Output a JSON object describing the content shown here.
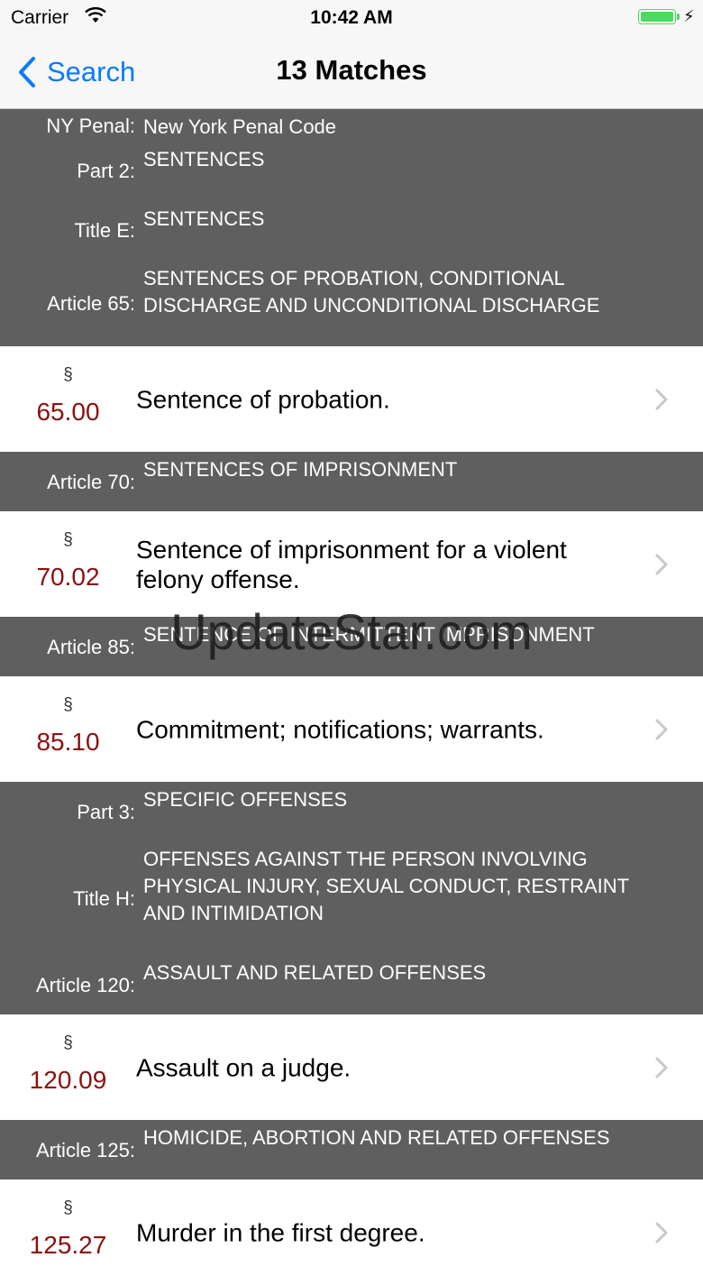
{
  "status_bar": {
    "carrier": "Carrier",
    "time": "10:42 AM"
  },
  "nav": {
    "back_label": "Search",
    "title": "13 Matches"
  },
  "header1": {
    "rows": [
      {
        "label": "NY Penal:",
        "text": "New York Penal Code"
      },
      {
        "label": "Part 2:",
        "text": "SENTENCES"
      },
      {
        "label": "Title E:",
        "text": "SENTENCES"
      },
      {
        "label": "Article 65:",
        "text": "SENTENCES OF PROBATION, CONDITIONAL DISCHARGE AND UNCONDITIONAL DISCHARGE"
      }
    ]
  },
  "row1": {
    "symbol": "§",
    "section": "65.00",
    "title": "Sentence of probation."
  },
  "header2": {
    "rows": [
      {
        "label": "Article 70:",
        "text": "SENTENCES OF IMPRISONMENT"
      }
    ]
  },
  "row2": {
    "symbol": "§",
    "section": "70.02",
    "title": "Sentence of imprisonment for a violent felony offense."
  },
  "header3": {
    "rows": [
      {
        "label": "Article 85:",
        "text": "SENTENCE OF INTERMITTENT IMPRISONMENT"
      }
    ]
  },
  "row3": {
    "symbol": "§",
    "section": "85.10",
    "title": "Commitment; notifications; warrants."
  },
  "header4": {
    "rows": [
      {
        "label": "Part 3:",
        "text": "SPECIFIC OFFENSES"
      },
      {
        "label": "Title H:",
        "text": "OFFENSES AGAINST THE PERSON INVOLVING PHYSICAL INJURY, SEXUAL CONDUCT, RESTRAINT AND INTIMIDATION"
      },
      {
        "label": "Article 120:",
        "text": "ASSAULT AND RELATED OFFENSES"
      }
    ]
  },
  "row4": {
    "symbol": "§",
    "section": "120.09",
    "title": "Assault on a judge."
  },
  "header5": {
    "rows": [
      {
        "label": "Article 125:",
        "text": "HOMICIDE, ABORTION AND RELATED OFFENSES"
      }
    ]
  },
  "row5": {
    "symbol": "§",
    "section": "125.27",
    "title": "Murder in the first degree."
  },
  "watermark": "UpdateStar.com",
  "colors": {
    "accent": "#0a7aff",
    "header_bg": "#5f5f5f",
    "section_number": "#8a1010",
    "battery": "#4cd964"
  }
}
